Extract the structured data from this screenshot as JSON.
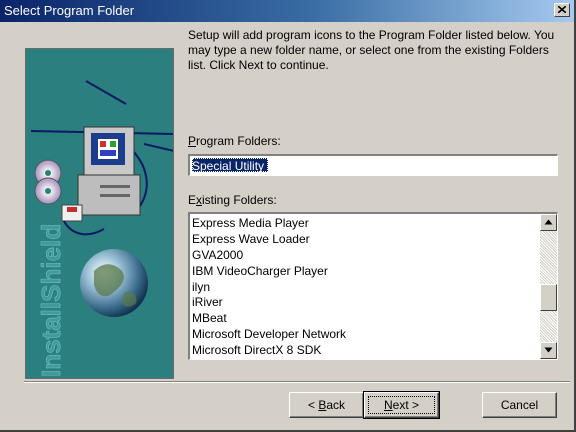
{
  "window": {
    "title": "Select Program Folder"
  },
  "art": {
    "brand": "InstallShield"
  },
  "intro": {
    "text": "Setup will add program icons to the Program Folder listed below. You may type a new folder name, or select one from the existing Folders list.  Click Next to continue."
  },
  "program_folders": {
    "label_key": "P",
    "label_rest": "rogram Folders:",
    "value": "Special Utility"
  },
  "existing_folders": {
    "label_pre": "E",
    "label_key": "x",
    "label_rest": "isting Folders:",
    "items": [
      "Express Media Player",
      "Express Wave Loader",
      "GVA2000",
      "IBM VideoCharger Player",
      "ilyn",
      "iRiver",
      "MBeat",
      "Microsoft Developer Network",
      "Microsoft DirectX 8 SDK"
    ]
  },
  "buttons": {
    "back_pre": "< ",
    "back_key": "B",
    "back_rest": "ack",
    "next_key": "N",
    "next_rest": "ext >",
    "cancel": "Cancel"
  },
  "colors": {
    "titlebar_start": "#0a246a",
    "titlebar_end": "#a6caf0",
    "dialog_face": "#d4d0c8",
    "art_background": "#2c7f7f",
    "selection": "#0a246a"
  },
  "icons": {
    "close": "close-x-icon",
    "scroll_up": "triangle-up-icon",
    "scroll_down": "triangle-down-icon",
    "art": [
      "computer-icon",
      "cd-disc-icon",
      "floppy-disk-icon",
      "globe-icon"
    ]
  }
}
